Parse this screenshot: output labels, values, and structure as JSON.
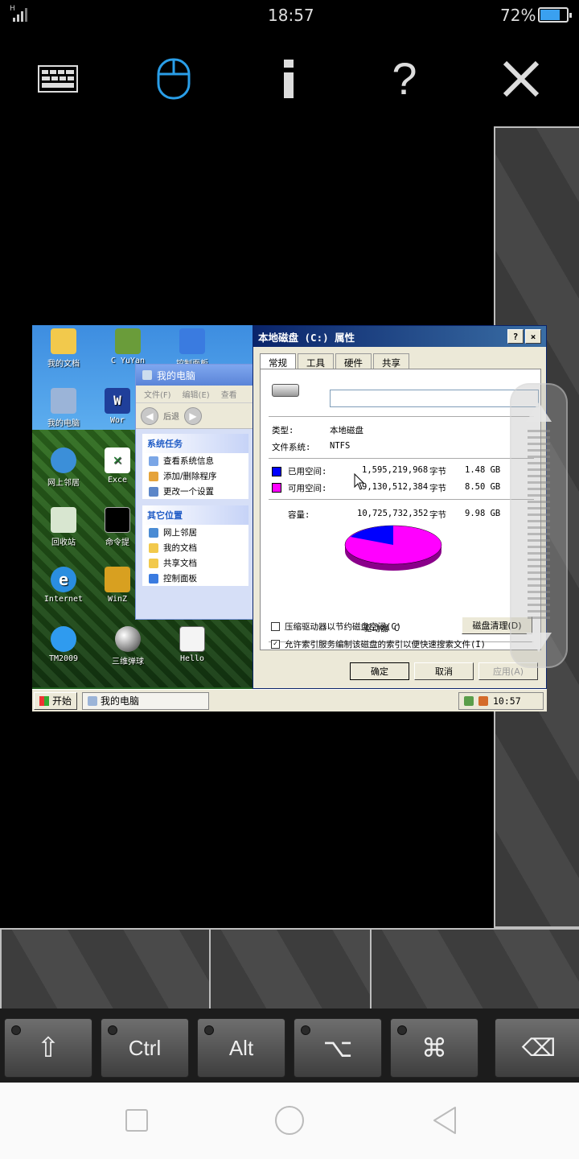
{
  "status": {
    "time": "18:57",
    "battery": "72%",
    "signal_label": "H"
  },
  "toolbar": {
    "icons": [
      "keyboard-icon",
      "mouse-icon",
      "info-icon",
      "help-icon",
      "close-icon"
    ]
  },
  "desktop": {
    "icons": [
      {
        "label": "我的文档"
      },
      {
        "label": "C YuYan"
      },
      {
        "label": "控制面板"
      },
      {
        "label": "我的电脑"
      },
      {
        "label": "Wor"
      },
      {
        "label": "网上邻居"
      },
      {
        "label": "Exce"
      },
      {
        "label": "回收站"
      },
      {
        "label": "命令提"
      },
      {
        "label": "Internet"
      },
      {
        "label": "WinZ"
      },
      {
        "label": "TM2009"
      },
      {
        "label": "三维弹球"
      },
      {
        "label": "Hello"
      }
    ]
  },
  "explorer": {
    "title": "我的电脑",
    "menu": [
      "文件(F)",
      "编辑(E)",
      "查看"
    ],
    "nav_back": "后退",
    "sys_tasks_title": "系统任务",
    "sys_tasks": [
      "查看系统信息",
      "添加/删除程序",
      "更改一个设置"
    ],
    "other_places_title": "其它位置",
    "other_places": [
      "网上邻居",
      "我的文档",
      "共享文档",
      "控制面板"
    ]
  },
  "dialog": {
    "title": "本地磁盘 (C:) 属性",
    "help_btn": "?",
    "close_btn": "×",
    "tabs": [
      "常规",
      "工具",
      "硬件",
      "共享"
    ],
    "name_value": "",
    "type_label": "类型:",
    "type_value": "本地磁盘",
    "fs_label": "文件系统:",
    "fs_value": "NTFS",
    "used_label": "已用空间:",
    "used_bytes": "1,595,219,968",
    "used_unit": "字节",
    "used_gb": "1.48 GB",
    "free_label": "可用空间:",
    "free_bytes": "9,130,512,384",
    "free_unit": "字节",
    "free_gb": "8.50 GB",
    "cap_label": "容量:",
    "cap_bytes": "10,725,732,352",
    "cap_unit": "字节",
    "cap_gb": "9.98 GB",
    "drive_label": "驱动器 C",
    "cleanup_btn": "磁盘清理(D)",
    "compress_label": "压缩驱动器以节约磁盘空间(C)",
    "index_label": "允许索引服务编制该磁盘的索引以便快速搜索文件(I)",
    "ok": "确定",
    "cancel": "取消",
    "apply": "应用(A)",
    "colors": {
      "used": "#0000ff",
      "free": "#ff00ff"
    }
  },
  "taskbar": {
    "start": "开始",
    "task": "我的电脑",
    "clock": "10:57"
  },
  "keys": {
    "shift": "⇧",
    "ctrl": "Ctrl",
    "alt": "Alt",
    "option": "⌥",
    "command": "⌘",
    "backspace": "⌫"
  }
}
